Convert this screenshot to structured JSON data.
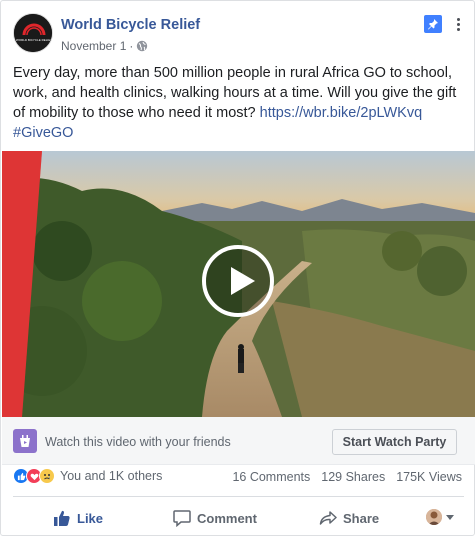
{
  "page": {
    "name": "World Bicycle Relief",
    "date": "November 1",
    "meta_separator": "·",
    "avatar_logo": "WORLD BICYCLE RELIEF"
  },
  "post": {
    "text": "Every day, more than 500 million people in rural Africa GO to school, work, and health clinics, walking hours at a time. Will you give the gift of mobility to those who need it most?",
    "link": "https://wbr.bike/2pLWKvq",
    "hashtag": "#GiveGO"
  },
  "watch_party": {
    "prompt": "Watch this video with your friends",
    "button_label": "Start Watch Party"
  },
  "engagement": {
    "reactions_text": "You and 1K others",
    "comments": "16 Comments",
    "shares": "129 Shares",
    "views": "175K Views",
    "reaction_types": [
      "like",
      "love",
      "sad"
    ]
  },
  "actions": {
    "like": "Like",
    "comment": "Comment",
    "share": "Share"
  },
  "colors": {
    "link": "#385898",
    "pin": "#4080ff",
    "watch_party_icon": "#8c72cb",
    "like": "#1877f2",
    "love": "#f33e58",
    "sad": "#f7c94c"
  },
  "icons": [
    "globe-icon",
    "pin-icon",
    "more-icon",
    "play-icon",
    "watch-party-icon",
    "like-icon",
    "comment-icon",
    "share-icon",
    "caret-icon"
  ]
}
